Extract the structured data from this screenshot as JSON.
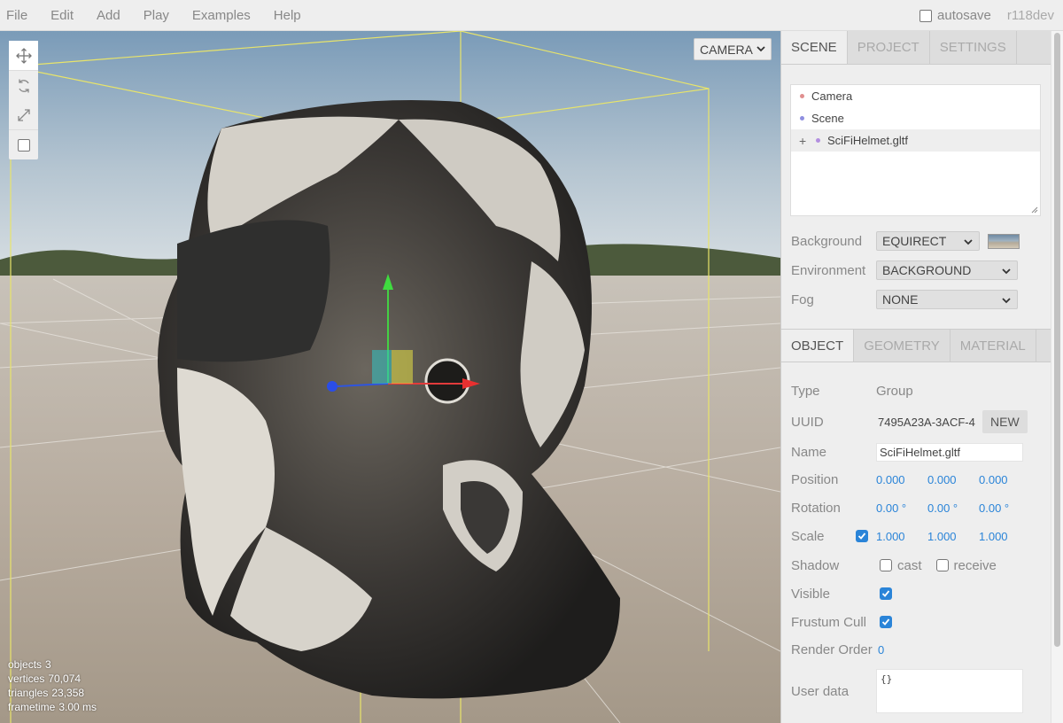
{
  "menubar": {
    "items": [
      "File",
      "Edit",
      "Add",
      "Play",
      "Examples",
      "Help"
    ],
    "autosave_label": "autosave",
    "autosave_checked": false,
    "version": "r118dev"
  },
  "viewport": {
    "camera_select": "CAMERA",
    "toolbar": [
      {
        "name": "translate-icon",
        "active": true
      },
      {
        "name": "rotate-icon",
        "active": false
      },
      {
        "name": "scale-icon",
        "active": false
      },
      {
        "name": "local-space-checkbox",
        "active": false
      }
    ],
    "info": {
      "objects_label": "objects",
      "objects": "3",
      "vertices_label": "vertices",
      "vertices": "70,074",
      "triangles_label": "triangles",
      "triangles": "23,358",
      "frametime_label": "frametime",
      "frametime": "3.00 ms"
    }
  },
  "sidebar": {
    "top_tabs": [
      "SCENE",
      "PROJECT",
      "SETTINGS"
    ],
    "outliner": [
      {
        "label": "Camera",
        "color": "#e08f8f",
        "plus": false
      },
      {
        "label": "Scene",
        "color": "#8f8fe0",
        "plus": false
      },
      {
        "label": "SciFiHelmet.gltf",
        "color": "#b38fe0",
        "plus": true
      }
    ],
    "background": {
      "label": "Background",
      "value": "EQUIRECT"
    },
    "environment": {
      "label": "Environment",
      "value": "BACKGROUND"
    },
    "fog": {
      "label": "Fog",
      "value": "NONE"
    },
    "object_tabs": [
      "OBJECT",
      "GEOMETRY",
      "MATERIAL"
    ],
    "object": {
      "type_label": "Type",
      "type": "Group",
      "uuid_label": "UUID",
      "uuid": "7495A23A-3ACF-4",
      "new_button": "NEW",
      "name_label": "Name",
      "name": "SciFiHelmet.gltf",
      "position_label": "Position",
      "position": [
        "0.000",
        "0.000",
        "0.000"
      ],
      "rotation_label": "Rotation",
      "rotation": [
        "0.00 °",
        "0.00 °",
        "0.00 °"
      ],
      "scale_label": "Scale",
      "scale": [
        "1.000",
        "1.000",
        "1.000"
      ],
      "shadow_label": "Shadow",
      "cast_label": "cast",
      "receive_label": "receive",
      "visible_label": "Visible",
      "frustum_label": "Frustum Cull",
      "render_order_label": "Render Order",
      "render_order": "0",
      "userdata_label": "User data",
      "userdata": "{}"
    }
  }
}
